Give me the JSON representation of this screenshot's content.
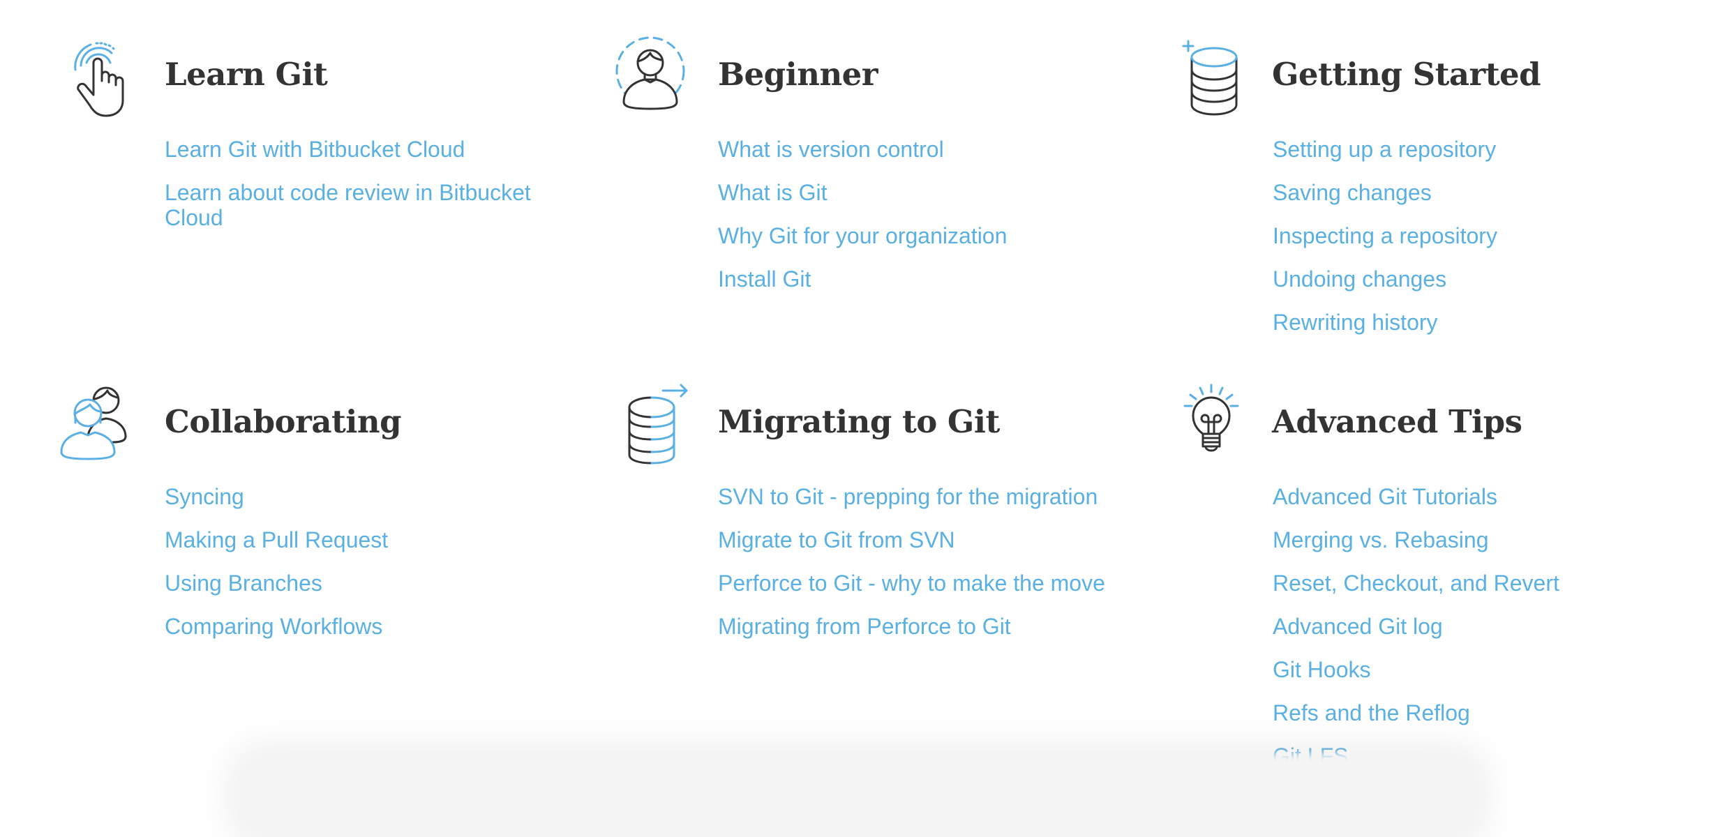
{
  "colors": {
    "link": "#5aafe3",
    "heading": "#333333",
    "icon_accent": "#5aafe3",
    "icon_dark": "#333333"
  },
  "sections": [
    {
      "title": "Learn Git",
      "icon": "tap-hand-icon",
      "links": [
        "Learn Git with Bitbucket Cloud",
        "Learn about code review in Bitbucket Cloud"
      ]
    },
    {
      "title": "Beginner",
      "icon": "user-avatar-icon",
      "links": [
        "What is version control",
        "What is Git",
        "Why Git for your organization",
        "Install Git"
      ]
    },
    {
      "title": "Getting Started",
      "icon": "database-add-icon",
      "links": [
        "Setting up a repository",
        "Saving changes",
        "Inspecting a repository",
        "Undoing changes",
        "Rewriting history"
      ]
    },
    {
      "title": "Collaborating",
      "icon": "two-users-icon",
      "links": [
        "Syncing",
        "Making a Pull Request",
        "Using Branches",
        "Comparing Workflows"
      ]
    },
    {
      "title": "Migrating to Git",
      "icon": "database-migrate-icon",
      "links": [
        "SVN to Git - prepping for the migration",
        "Migrate to Git from SVN",
        "Perforce to Git - why to make the move",
        "Migrating from Perforce to Git"
      ]
    },
    {
      "title": "Advanced Tips",
      "icon": "lightbulb-icon",
      "links": [
        "Advanced Git Tutorials",
        "Merging vs. Rebasing",
        "Reset, Checkout, and Revert",
        "Advanced Git log",
        "Git Hooks",
        "Refs and the Reflog",
        "Git LFS"
      ]
    }
  ]
}
